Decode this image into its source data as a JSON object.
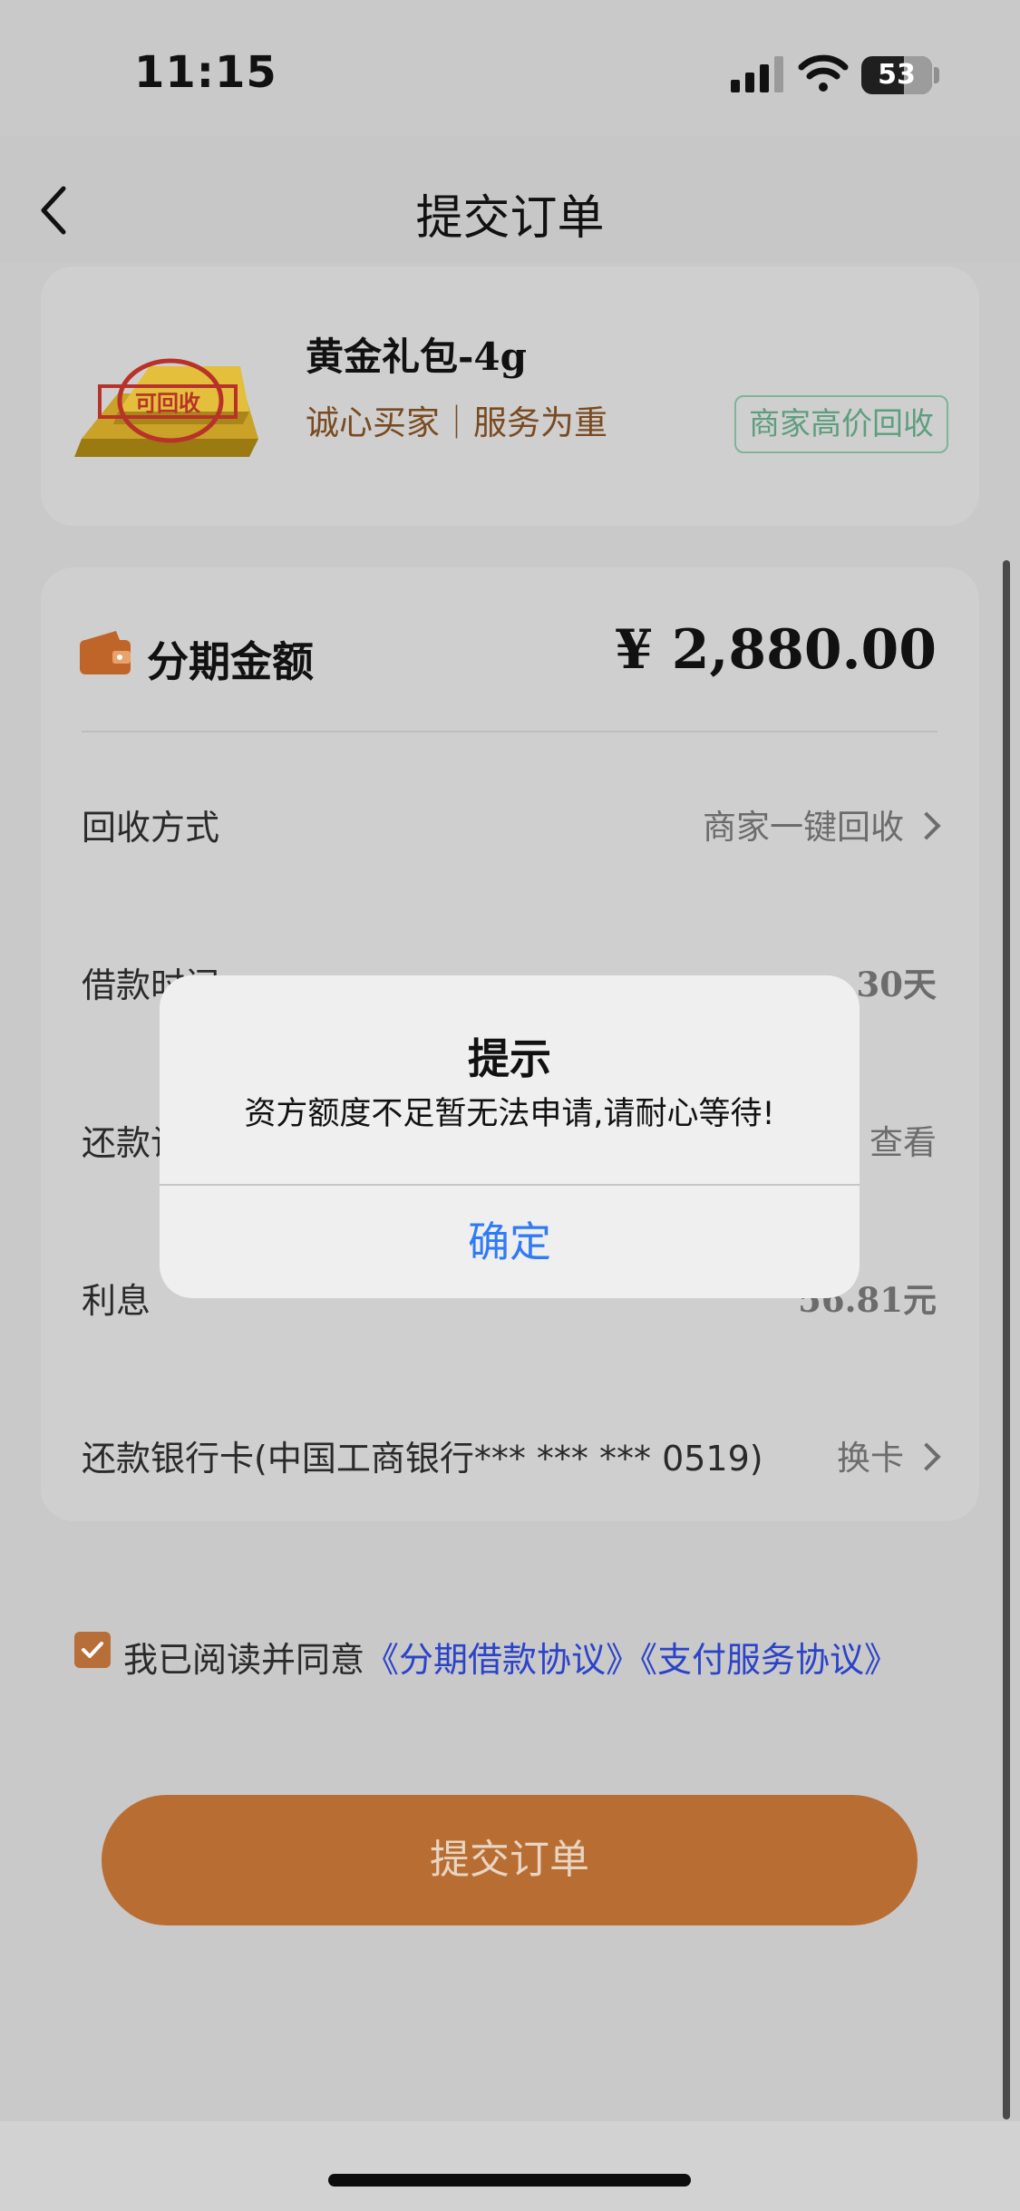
{
  "status_bar": {
    "time": "11:15",
    "battery": "53"
  },
  "header": {
    "title": "提交订单"
  },
  "product": {
    "name": "黄金礼包-4g",
    "slogan": "诚心买家｜服务为重",
    "badge": "商家高价回收",
    "image_stamp": "可回收"
  },
  "installment": {
    "label": "分期金额",
    "amount": "¥ 2,880.00",
    "rows": [
      {
        "label": "回收方式",
        "value": "商家一键回收"
      },
      {
        "label": "借款时间",
        "value": "30天"
      },
      {
        "label": "还款计划",
        "value": "查看"
      },
      {
        "label": "利息",
        "value": "56.81元"
      },
      {
        "label": "还款银行卡(中国工商银行*** *** *** 0519)",
        "value": "换卡"
      }
    ]
  },
  "agreement": {
    "text": "我已阅读并同意",
    "link1": "《分期借款协议》",
    "link2": "《支付服务协议》"
  },
  "submit_label": "提交订单",
  "dialog": {
    "title": "提示",
    "message": "资方额度不足暂无法申请,请耐心等待!",
    "confirm": "确定"
  },
  "colors": {
    "accent": "#b86e33",
    "link": "#2b43c9",
    "dialog_button": "#2f7bf6",
    "badge": "#5e9e7e"
  }
}
